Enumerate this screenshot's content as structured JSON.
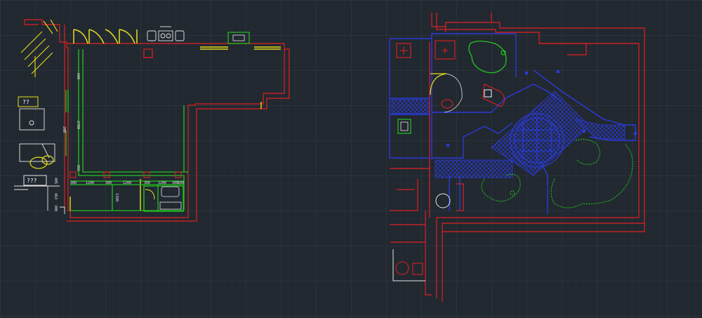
{
  "app": "CAD drawing viewport",
  "colors": {
    "background": "#212830",
    "grid_minor": "#2a323b",
    "grid_major": "#323c46",
    "wall_red": "#e02020",
    "wall_blue": "#2b3bd9",
    "green": "#22c41f",
    "yellow": "#e8e01c",
    "white": "#e6e6e6"
  },
  "left_plan": {
    "labels": [
      "??",
      "???"
    ],
    "top_dims": [
      "300",
      "1200",
      "300",
      "1200",
      "300",
      "1200",
      "300",
      "600"
    ],
    "side_dims": [
      "600",
      "1200",
      "200",
      "405",
      "463",
      "300"
    ],
    "vertical_dims": [
      "2700",
      "1390",
      "655"
    ]
  },
  "right_plan": {
    "icons": [
      "bathtub-icon",
      "toilet-icon",
      "washbasin-icon",
      "stair-icon",
      "tree-icon"
    ]
  }
}
